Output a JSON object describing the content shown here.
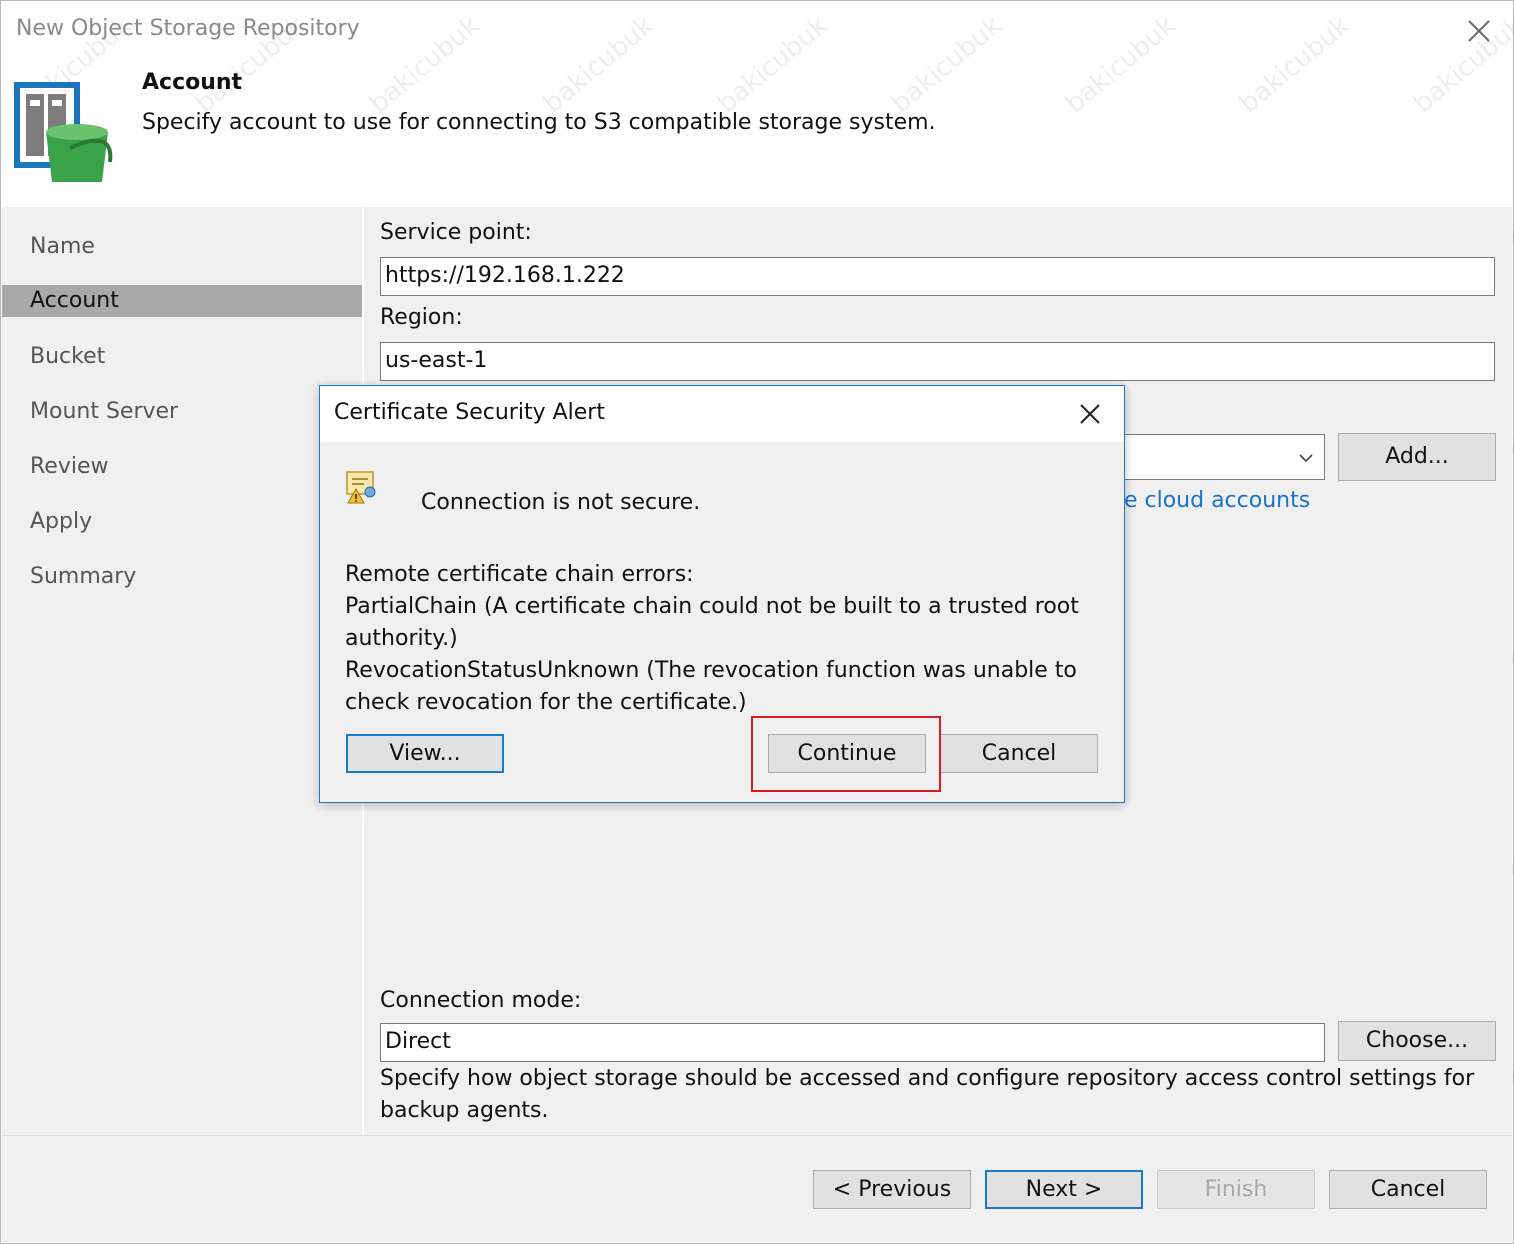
{
  "window": {
    "title": "New Object Storage Repository"
  },
  "header": {
    "title": "Account",
    "description": "Specify account to use for connecting to S3 compatible storage system."
  },
  "steps": [
    "Name",
    "Account",
    "Bucket",
    "Mount Server",
    "Review",
    "Apply",
    "Summary"
  ],
  "active_step": "Account",
  "form": {
    "service_point_label": "Service point:",
    "service_point_value": "https://192.168.1.222",
    "region_label": "Region:",
    "region_value": "us-east-1",
    "add_button": "Add...",
    "manage_link_visible": "ge cloud accounts",
    "connection_mode_label": "Connection mode:",
    "connection_mode_value": "Direct",
    "choose_button": "Choose...",
    "connection_mode_help_1": "Specify how object storage should be accessed and configure repository access control settings for",
    "connection_mode_help_2": "backup agents."
  },
  "footer": {
    "previous": "< Previous",
    "next": "Next >",
    "finish": "Finish",
    "cancel": "Cancel"
  },
  "dialog": {
    "title": "Certificate Security Alert",
    "headline": "Connection is not secure.",
    "lines": [
      "Remote certificate chain errors:",
      "PartialChain (A certificate chain could not be built to a trusted root",
      "authority.)",
      "RevocationStatusUnknown (The revocation function was unable to",
      "check revocation for the certificate.)"
    ],
    "view_button": "View...",
    "continue_button": "Continue",
    "cancel_button": "Cancel"
  },
  "watermark": "bakicubuk",
  "colors": {
    "accent": "#1979ca",
    "link": "#1a73c9",
    "highlight": "#d81e1e",
    "active_step_bg": "#a9a9a9",
    "panel_bg": "#f0f0f0",
    "icon_green": "#3aa34a",
    "icon_blue": "#1b75bb"
  },
  "icons": {
    "window_close": "close-icon",
    "wizard": "object-storage-bucket-icon",
    "dialog_close": "close-icon",
    "certificate": "certificate-warning-icon",
    "dropdown": "chevron-down-icon"
  }
}
